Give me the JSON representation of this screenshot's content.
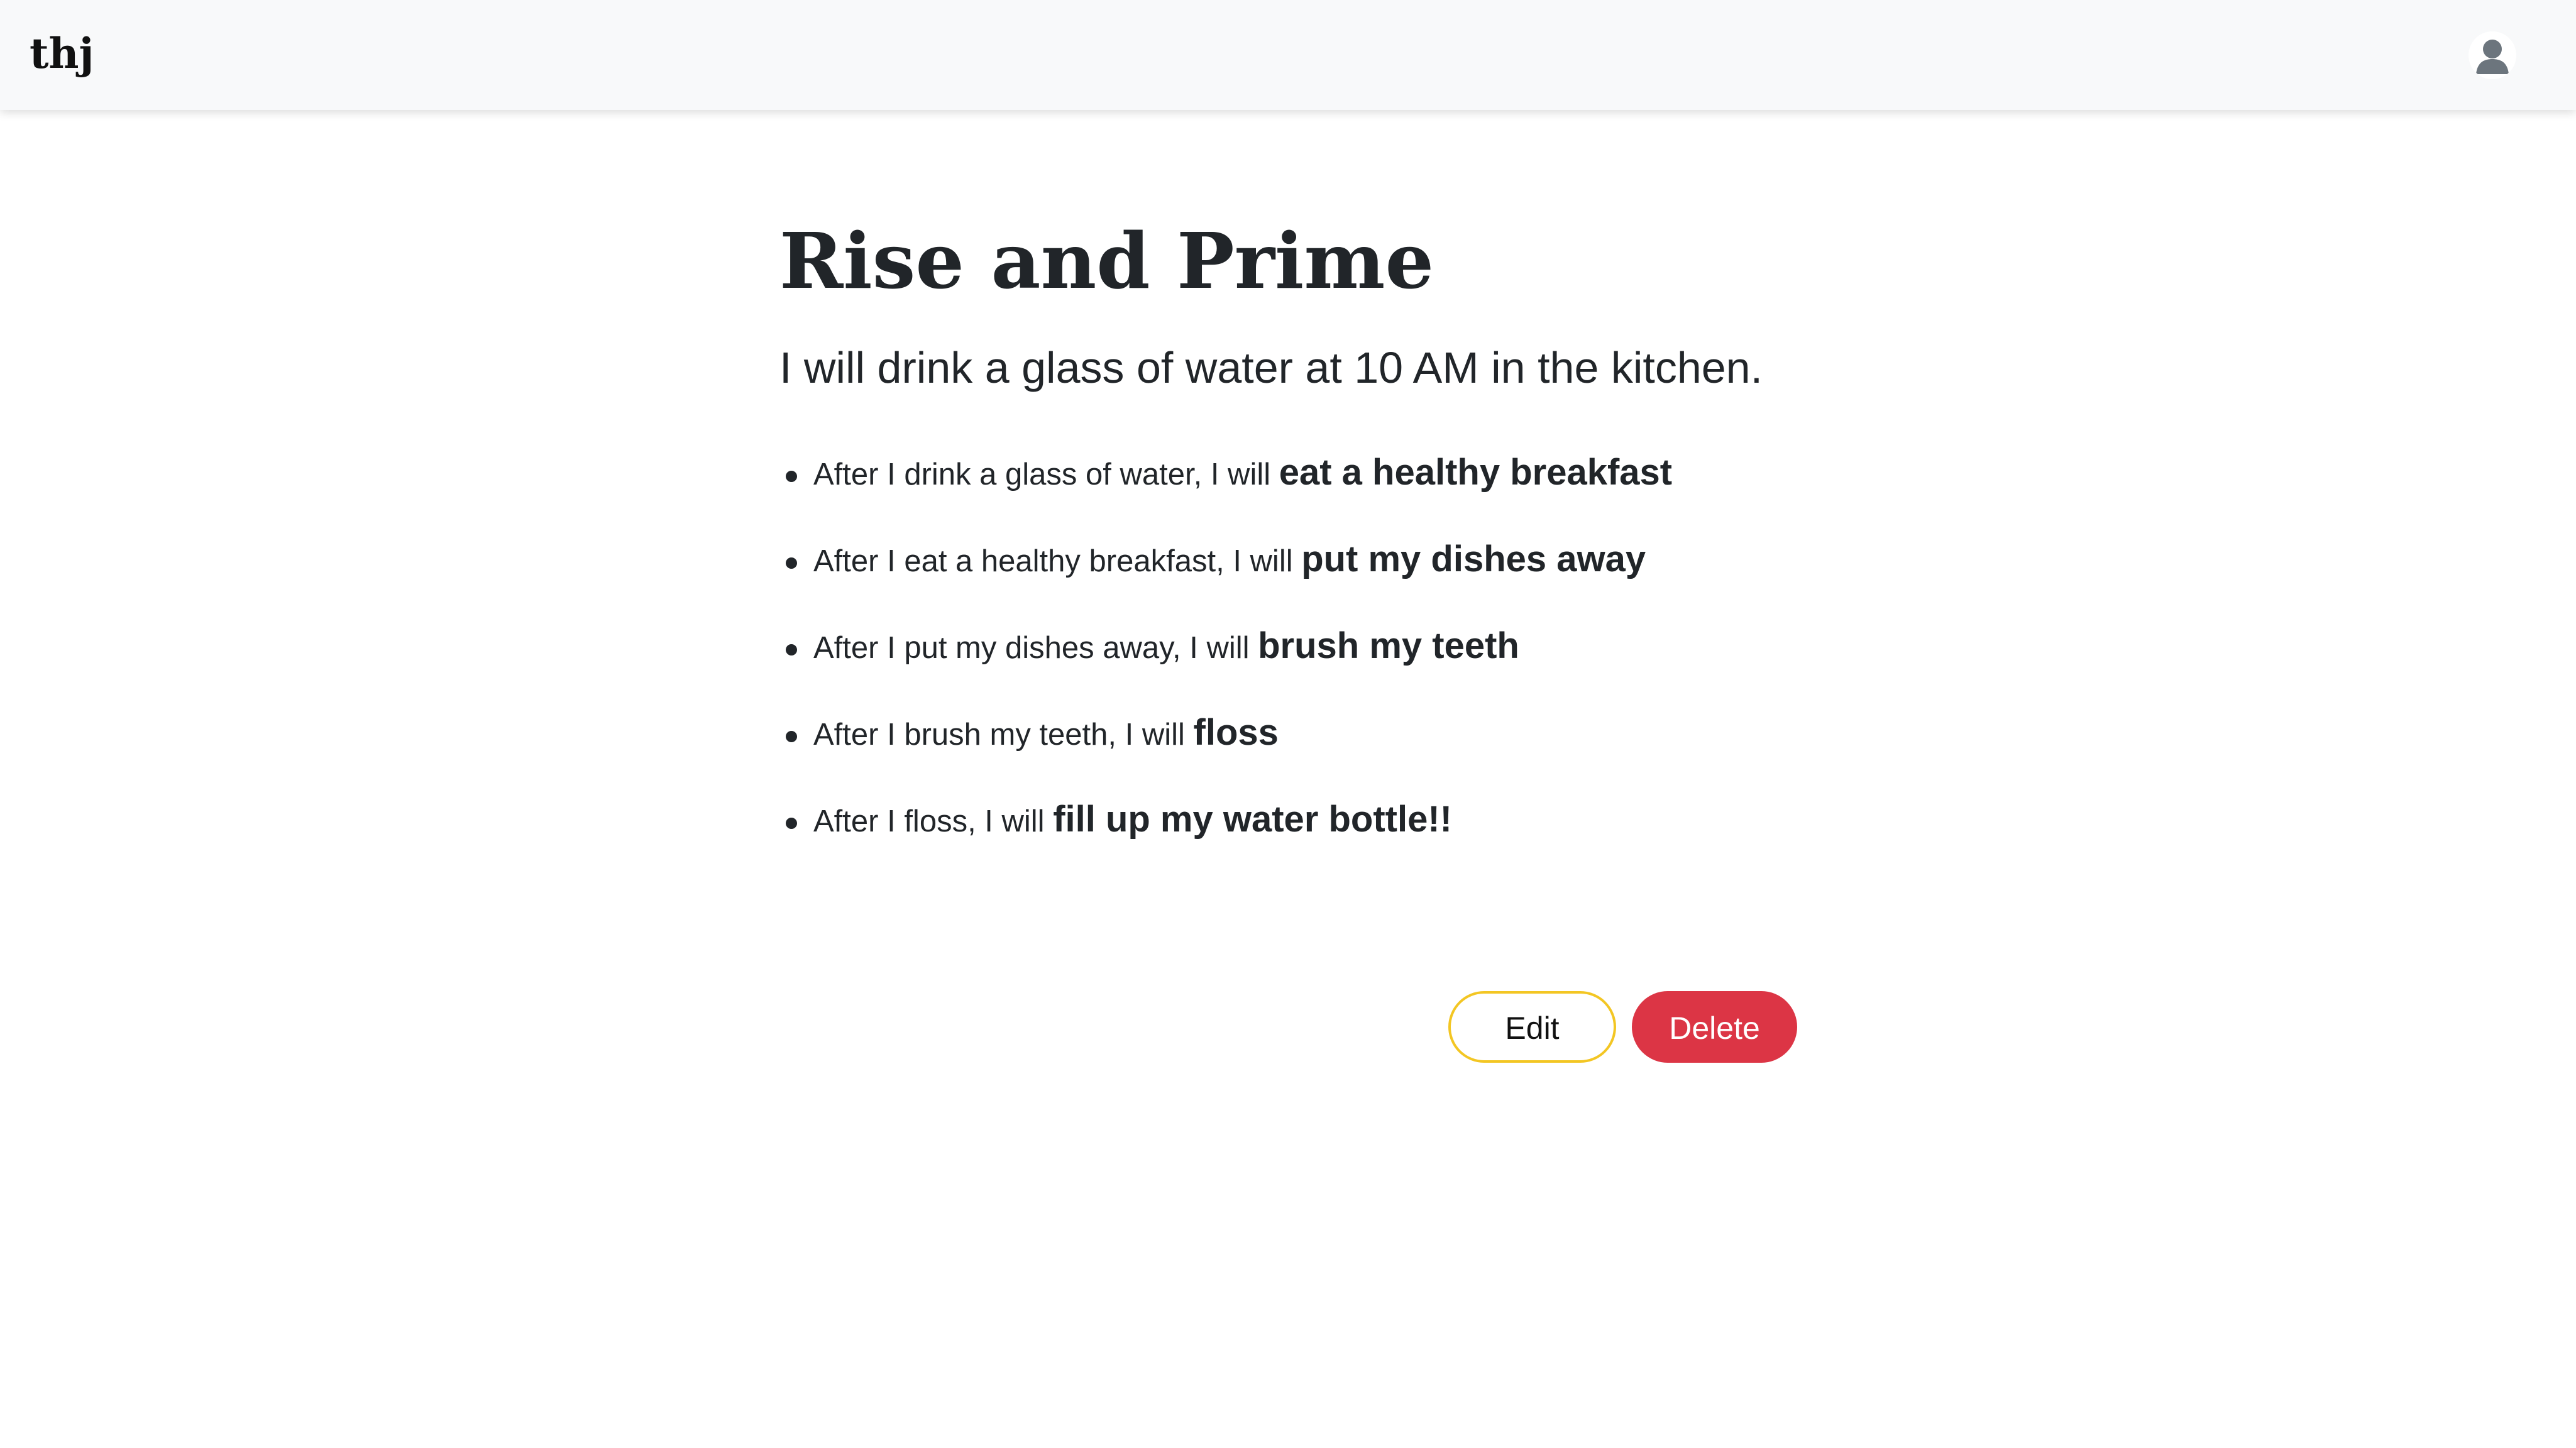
{
  "navbar": {
    "brand": "thj",
    "avatar_icon": "user-avatar-icon"
  },
  "habit_stack": {
    "title": "Rise and Prime",
    "intention": "I will drink a glass of water at 10 AM in the kitchen.",
    "items": [
      {
        "prefix": "After I drink a glass of water, I will ",
        "habit": "eat a healthy breakfast"
      },
      {
        "prefix": "After I eat a healthy breakfast, I will ",
        "habit": "put my dishes away"
      },
      {
        "prefix": "After I put my dishes away, I will ",
        "habit": "brush my teeth"
      },
      {
        "prefix": "After I brush my teeth, I will ",
        "habit": "floss"
      },
      {
        "prefix": "After I floss, I will ",
        "habit": "fill up my water bottle!!"
      }
    ]
  },
  "actions": {
    "edit_label": "Edit",
    "delete_label": "Delete"
  },
  "colors": {
    "navbar_bg": "#f8f9fa",
    "edit_border": "#f3c623",
    "delete_bg": "#dc3545",
    "text": "#212529"
  }
}
